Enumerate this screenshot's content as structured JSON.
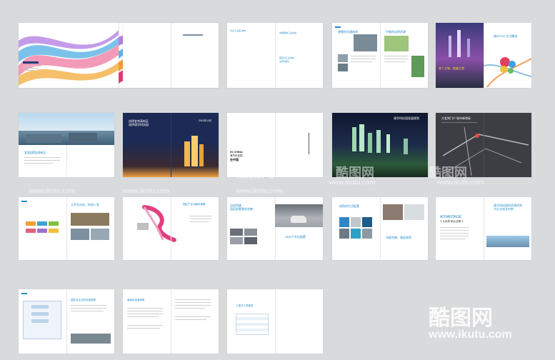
{
  "colors": {
    "background": "#d9dadc",
    "accent_blue": "#1e88c8",
    "navy": "#1c2a55",
    "dark_gray": "#3d3d44"
  },
  "watermark": {
    "brand": "酷图网",
    "url": "www.ikutu.com"
  },
  "spreads": {
    "s11": {
      "left_text": "九州工业园 吉林"
    },
    "s12": {
      "cover_title_1": "中国通信工业协会",
      "cover_title_2": "固定式工业吊车",
      "cover_title_3": "[宣传资料]"
    },
    "s13": {
      "left_heading": "便捷的交通体系",
      "right_heading": "平衡的自然资源"
    },
    "s14": {
      "heading": "城市TOD  生活概览",
      "subheading": "宜人之城，度越之地"
    },
    "s21": {
      "caption": "宜居[国家]高新区"
    },
    "s22": {
      "left_title_1": "选择宜宾高新区",
      "left_title_2": "选择清华科技园",
      "right_title": "2011年12月"
    },
    "s23": {
      "line_1": "IN CHINA",
      "line_2": "清华科技园",
      "line_3": "在中国"
    },
    "s24": {
      "title": "清华科技园发展规划"
    },
    "s25": {
      "heading": "大宜宾门户  城市新地标"
    },
    "s31": {
      "heading": "大学生创业，样创入驻"
    },
    "s32": {
      "right_heading": "园区产业功能布局图"
    },
    "s33": {
      "left_heading_1": "自由驾驶",
      "left_heading_2": "园区配套服务完善",
      "right_heading": "2800个车位配置"
    },
    "s34": {
      "left_heading": "成熟的生活配套",
      "right_heading": "功能完善，服务周到"
    },
    "s35": {
      "left_heading": "ADVANTAGE",
      "left_subheading": "十大优势  助企业腾飞",
      "right_heading_1": "清华科技园的资源优势",
      "right_heading_2": "为企业成长护航"
    },
    "s41": {
      "right_heading": "园区对企业的优惠政策"
    },
    "s42": {
      "right_heading": "高新区优惠政策"
    },
    "s43": {
      "left_heading": "三类式人员服务"
    }
  }
}
